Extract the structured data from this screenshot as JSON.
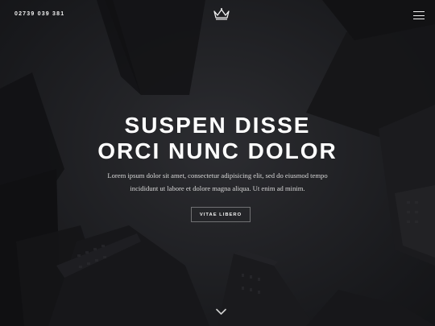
{
  "header": {
    "phone": "02739 039 381",
    "logo_icon": "crown-icon",
    "menu_icon": "hamburger-menu-icon"
  },
  "hero": {
    "headline_line1": "SUSPEN DISSE",
    "headline_line2": "ORCI NUNC DOLOR",
    "subtext_line1": "Lorem ipsum dolor sit amet, consectetur adipisicing elit, sed do eiusmod tempo",
    "subtext_line2": "incididunt ut labore et dolore magna aliqua. Ut enim ad minim.",
    "cta_label": "VITAE LIBERO",
    "scroll_icon": "chevron-down-icon"
  },
  "colors": {
    "text": "#ffffff",
    "background": "#1d1e21"
  }
}
